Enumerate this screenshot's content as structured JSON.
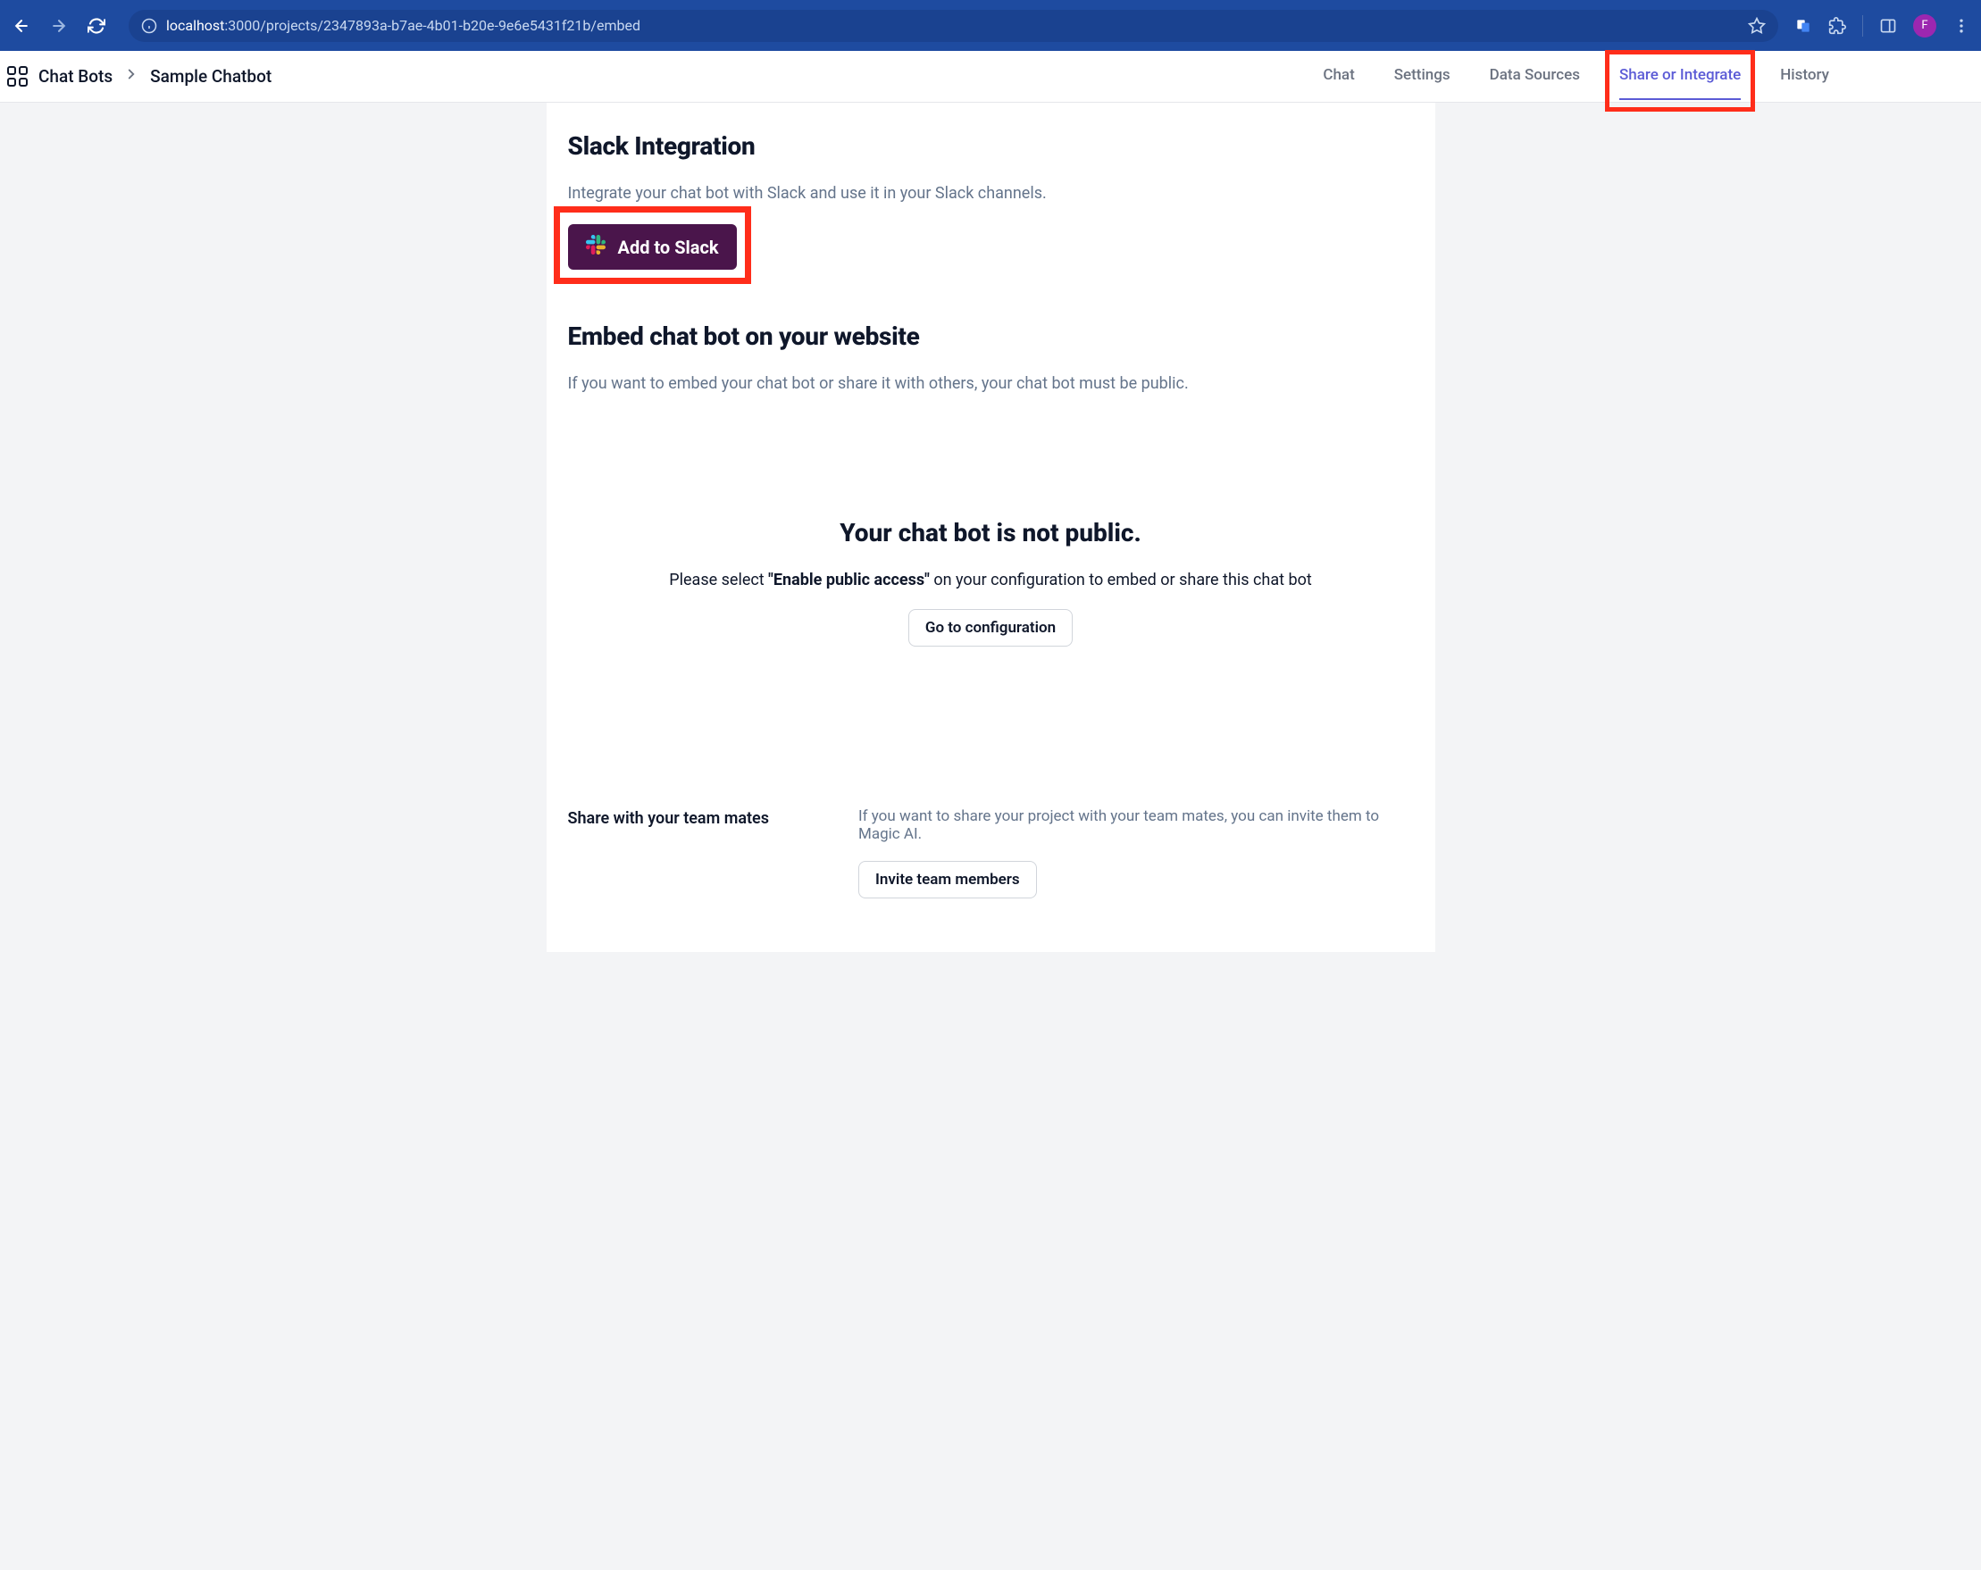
{
  "browser": {
    "url_host": "localhost",
    "url_rest": ":3000/projects/2347893a-b7ae-4b01-b20e-9e6e5431f21b/embed",
    "avatar_letter": "F"
  },
  "breadcrumb": {
    "root": "Chat Bots",
    "current": "Sample Chatbot"
  },
  "tabs": {
    "chat": "Chat",
    "settings": "Settings",
    "data_sources": "Data Sources",
    "share": "Share or Integrate",
    "history": "History"
  },
  "slack": {
    "title": "Slack Integration",
    "desc": "Integrate your chat bot with Slack and use it in your Slack channels.",
    "button_label": "Add to Slack"
  },
  "embed": {
    "title": "Embed chat bot on your website",
    "desc": "If you want to embed your chat bot or share it with others, your chat bot must be public."
  },
  "not_public": {
    "title": "Your chat bot is not public.",
    "desc_pre": "Please select ",
    "desc_bold": "\"Enable public access\"",
    "desc_post": " on your configuration to embed or share this chat bot",
    "button": "Go to configuration"
  },
  "team": {
    "left_label": "Share with your team mates",
    "desc": "If you want to share your project with your team mates, you can invite them to Magic AI.",
    "button": "Invite team members"
  }
}
